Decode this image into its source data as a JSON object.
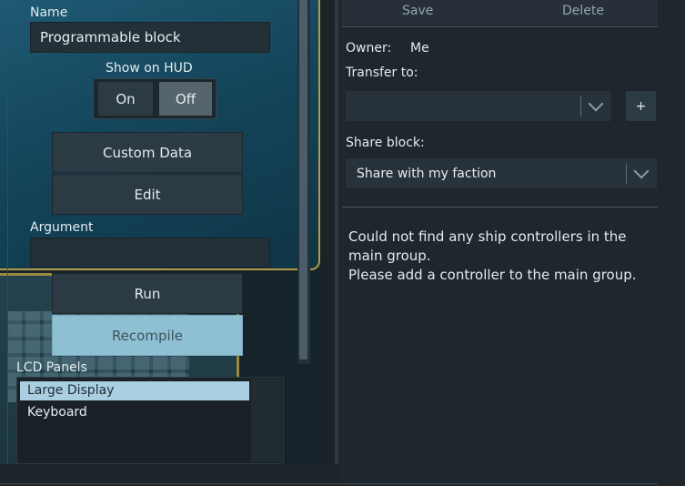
{
  "left": {
    "name_label": "Name",
    "name_value": "Programmable block",
    "show_on_hud_label": "Show on HUD",
    "hud_on_label": "On",
    "hud_off_label": "Off",
    "custom_data_label": "Custom Data",
    "edit_label": "Edit",
    "argument_label": "Argument",
    "argument_value": "",
    "run_label": "Run",
    "recompile_label": "Recompile",
    "lcd_panels_label": "LCD Panels",
    "lcd_items": [
      "Large Display",
      "Keyboard"
    ]
  },
  "right": {
    "save_label": "Save",
    "delete_label": "Delete",
    "owner_label": "Owner:",
    "owner_value": "Me",
    "transfer_label": "Transfer to:",
    "transfer_value": "",
    "add_label": "+",
    "share_label": "Share block:",
    "share_value": "Share with my faction",
    "message_line1": "Could not find any ship controllers in the main group.",
    "message_line2": "Please add a controller to the main group."
  },
  "colors": {
    "accent_selected": "#8fbfd3",
    "button_bg": "#2c3a44",
    "panel_bg": "#1f262c"
  }
}
